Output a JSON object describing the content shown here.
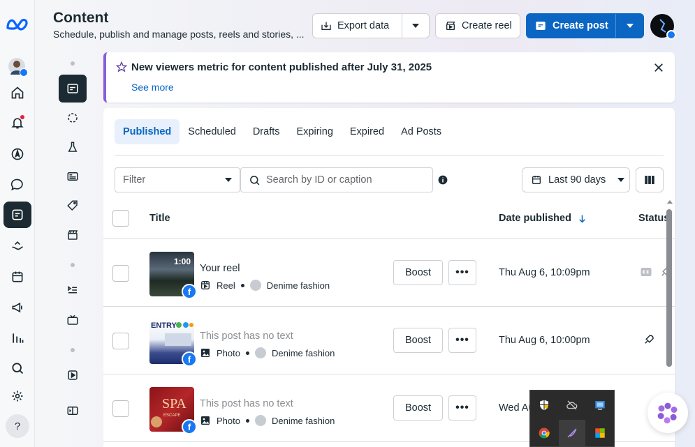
{
  "header": {
    "title": "Content",
    "subtitle": "Schedule, publish and manage posts, reels and stories, ...",
    "export_label": "Export data",
    "create_reel_label": "Create reel",
    "create_post_label": "Create post"
  },
  "banner": {
    "title": "New viewers metric for content published after July 31, 2025",
    "link": "See more"
  },
  "tabs": [
    {
      "label": "Published",
      "active": true
    },
    {
      "label": "Scheduled"
    },
    {
      "label": "Drafts"
    },
    {
      "label": "Expiring"
    },
    {
      "label": "Expired"
    },
    {
      "label": "Ad Posts"
    }
  ],
  "toolbar": {
    "filter_placeholder": "Filter",
    "search_placeholder": "Search by ID or caption",
    "date_range": "Last 90 days"
  },
  "table": {
    "columns": [
      "Title",
      "Date published",
      "Status"
    ],
    "boost_label": "Boost",
    "more_label": "•••",
    "rows": [
      {
        "title": "Your reel",
        "type": "Reel",
        "page": "Denime fashion",
        "date": "Thu Aug 6, 10:09pm",
        "duration": "1:00"
      },
      {
        "title": "This post has no text",
        "type": "Photo",
        "page": "Denime fashion",
        "date": "Thu Aug 6, 10:00pm"
      },
      {
        "title": "This post has no text",
        "type": "Photo",
        "page": "Denime fashion",
        "date": "Wed Au"
      }
    ]
  },
  "help_label": "?",
  "colors": {
    "primary": "#0a66c2",
    "accent_purple": "#8a5dd8",
    "facebook": "#1877f2",
    "dark": "#1c2b33"
  }
}
